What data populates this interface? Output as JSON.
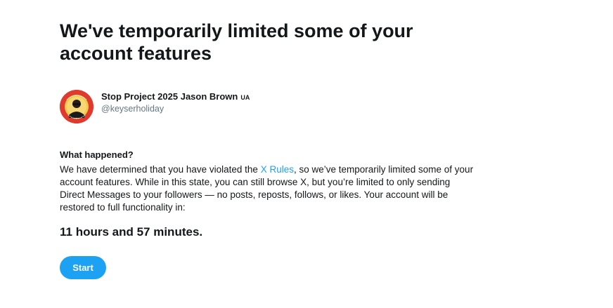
{
  "headline": "We've temporarily limited some of your account features",
  "account": {
    "display_name": "Stop Project 2025 Jason Brown",
    "name_suffix": "UA",
    "handle": "@keyserholiday",
    "avatar_icon": "profile-photo-with-red-badge"
  },
  "what_happened": {
    "title": "What happened?",
    "text_before_link": "We have determined that you have violated the ",
    "link_text": "X Rules",
    "text_after_link": ", so we’ve temporarily limited some of your account features. While in this state, you can still browse X, but you’re limited to only sending Direct Messages to your followers — no posts, reposts, follows, or likes. Your account will be restored to full functionality in:"
  },
  "countdown": "11 hours and 57 minutes.",
  "start_button_label": "Start",
  "colors": {
    "accent": "#1da1f2",
    "text": "#14171a",
    "secondary_text": "#657786",
    "avatar_badge": "#e0392e"
  }
}
